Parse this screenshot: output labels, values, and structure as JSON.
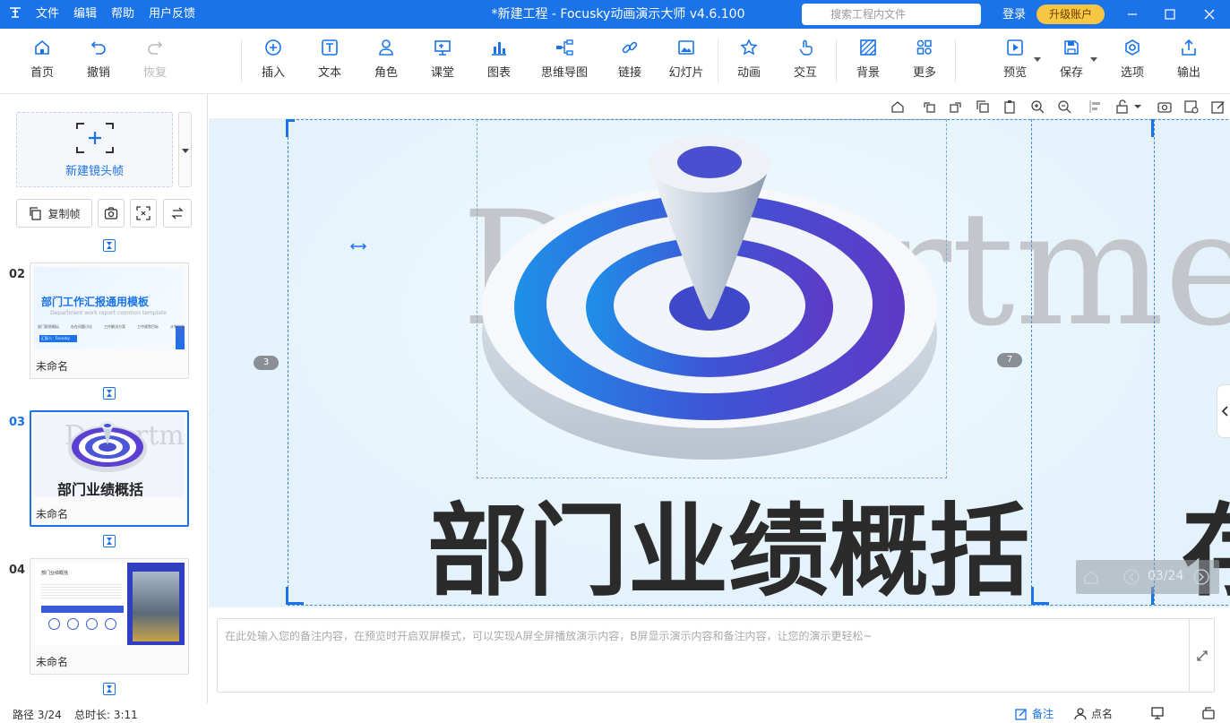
{
  "titlebar": {
    "menu": [
      "文件",
      "编辑",
      "帮助",
      "用户反馈"
    ],
    "title": "*新建工程 - Focusky动画演示大师  v4.6.100",
    "search_placeholder": "搜索工程内文件",
    "login": "登录",
    "upgrade": "升级账户"
  },
  "toolbar": {
    "home": "首页",
    "undo": "撤销",
    "redo": "恢复",
    "insert": "插入",
    "text": "文本",
    "role": "角色",
    "class": "课堂",
    "chart": "图表",
    "mindmap": "思维导图",
    "link": "链接",
    "slide": "幻灯片",
    "animation": "动画",
    "interact": "交互",
    "background": "背景",
    "more": "更多",
    "preview": "预览",
    "save": "保存",
    "options": "选项",
    "export": "输出"
  },
  "left": {
    "new_frame": "新建镜头帧",
    "copy_frame": "复制帧",
    "slides": [
      {
        "num": "02",
        "label": "未命名",
        "title": "部门工作汇报通用模板",
        "subtitle": "Department work report common template",
        "items": [
          "部门职责概括",
          "存在问题讨论",
          "工作解决方案",
          "工作规划目标",
          "计划实施"
        ],
        "author": "汇报人：Focusky"
      },
      {
        "num": "03",
        "label": "未命名",
        "title": "部门业绩概括",
        "bg_word": "Departm"
      },
      {
        "num": "04",
        "label": "未命名",
        "title": "部门业绩概括"
      }
    ]
  },
  "stage": {
    "bg_word": "Departme",
    "title": "部门业绩概括",
    "title_partial": "存",
    "frame_badge_left": "3",
    "frame_badge_right": "7",
    "page_indicator": "03/24"
  },
  "notes": {
    "placeholder": "在此处输入您的备注内容，在预览时开启双屏模式，可以实现A屏全屏播放演示内容，B屏显示演示内容和备注内容，让您的演示更轻松~"
  },
  "status": {
    "path": "路径 3/24",
    "duration": "总时长: 3:11",
    "notes": "备注",
    "rollcall": "点名"
  },
  "colors": {
    "accent": "#1a73e8",
    "upgrade": "#f7c744"
  }
}
